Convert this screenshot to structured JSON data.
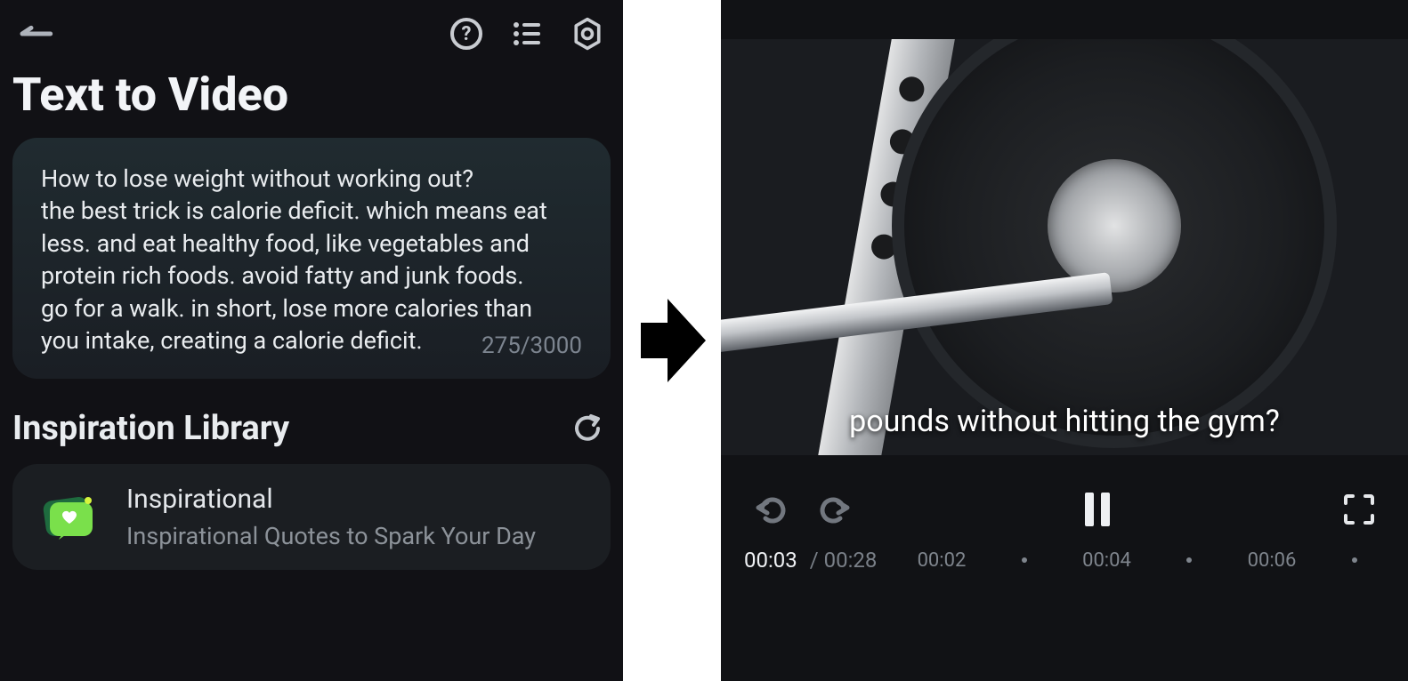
{
  "leftPanel": {
    "pageTitle": "Text to Video",
    "textInput": {
      "content": "How to lose weight without working out?\nthe best trick is calorie deficit. which means eat less. and eat healthy food, like vegetables and protein rich foods. avoid fatty and junk foods. go for a walk. in short, lose more calories than you intake, creating a calorie deficit.",
      "charCount": "275/3000"
    },
    "inspirationSection": {
      "title": "Inspiration Library",
      "card": {
        "title": "Inspirational",
        "subtitle": "Inspirational Quotes to Spark Your Day"
      }
    }
  },
  "rightPanel": {
    "caption": "pounds without hitting the gym?",
    "time": {
      "current": "00:03",
      "total": "00:28"
    },
    "timelineMarks": [
      "00:02",
      "00:04",
      "00:06"
    ]
  }
}
